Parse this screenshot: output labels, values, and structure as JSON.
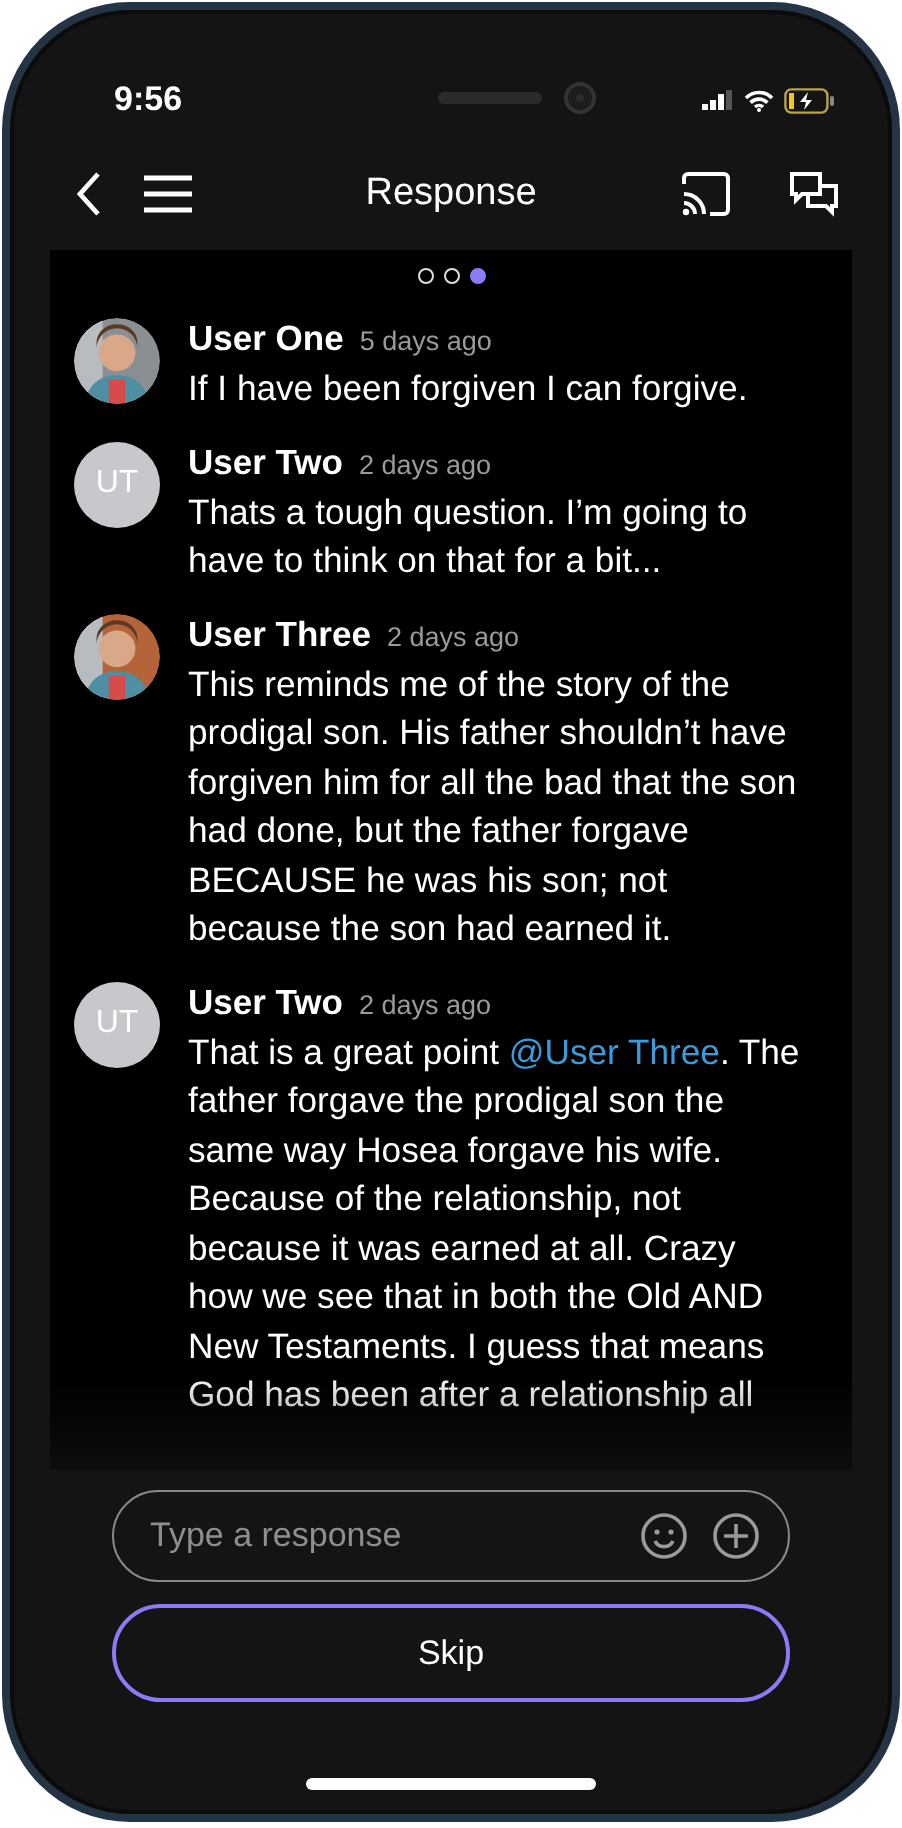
{
  "status_bar": {
    "time": "9:56"
  },
  "header": {
    "title": "Response"
  },
  "pager": [
    {
      "selected": false
    },
    {
      "selected": false
    },
    {
      "selected": true
    }
  ],
  "comments": [
    {
      "author": "User One",
      "time": "5 days ago",
      "body": [
        {
          "text": "If I have been forgiven I can forgive."
        }
      ]
    },
    {
      "author": "User Two",
      "time": "2 days ago",
      "avatar": {
        "kind": "initials",
        "initials": "UT"
      },
      "body": [
        {
          "text": "Thats a tough question. I’m going to have to think on that for a bit..."
        }
      ]
    },
    {
      "author": "User Three",
      "time": "2 days ago",
      "body": [
        {
          "text": "This reminds me of the story of the prodigal son. His father shouldn’t have forgiven him for all the bad that the son had done, but the father forgave BECAUSE he was his son; not because the son had earned it."
        }
      ]
    },
    {
      "author": "User Two",
      "time": "2 days ago",
      "avatar": {
        "kind": "initials",
        "initials": "UT"
      },
      "body": [
        {
          "text": "That is a great point "
        },
        {
          "text": "@User Three",
          "kind": "mention"
        },
        {
          "text": ". The father forgave the prodigal son the same way Hosea forgave his wife. Because of the relationship, not because it was earned at all. Crazy how we see that in both the Old AND New Testaments. I guess that means God has been after a relationship all"
        }
      ]
    }
  ],
  "composer": {
    "placeholder": "Type a response"
  },
  "skip_button": {
    "label": "Skip"
  }
}
